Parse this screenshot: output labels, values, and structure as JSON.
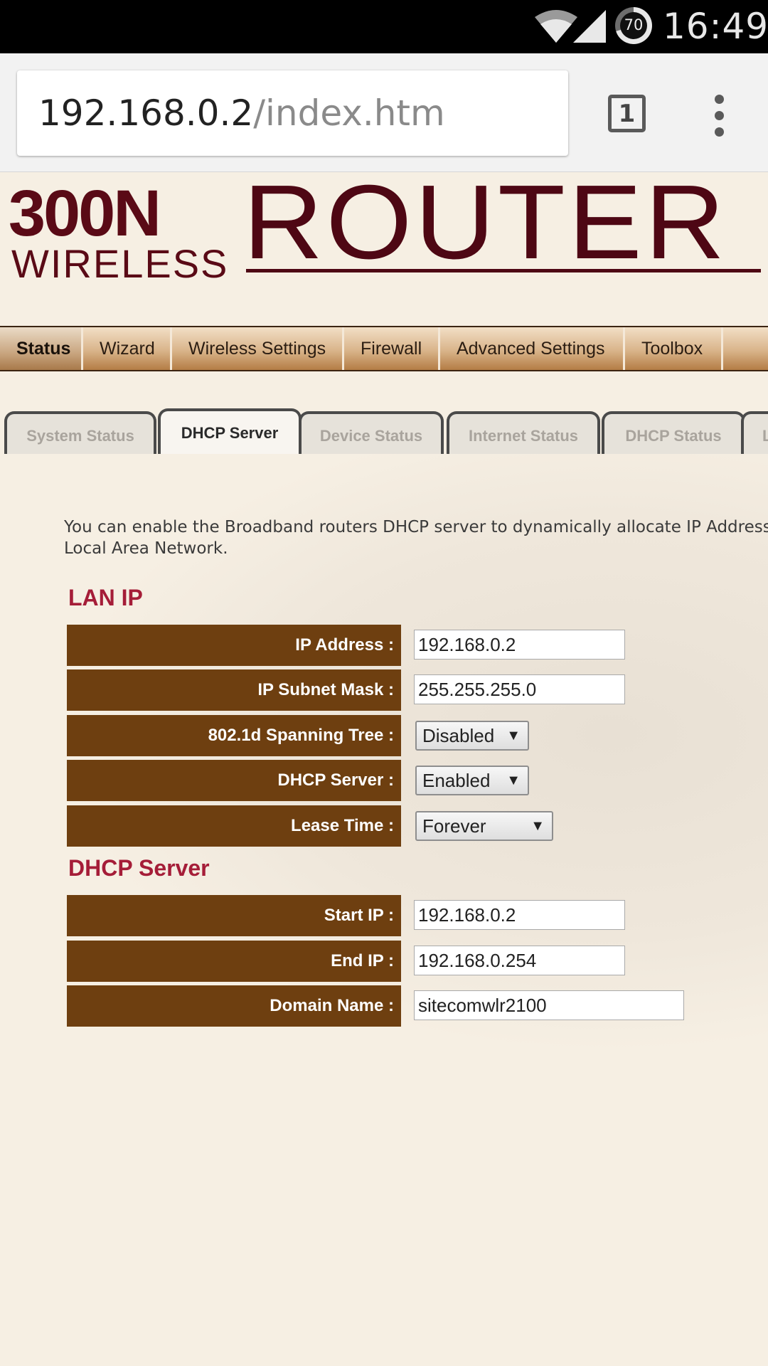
{
  "status_bar": {
    "battery_level": "70",
    "time": "16:49"
  },
  "browser": {
    "url_host": "192.168.0.2",
    "url_path": "/index.htm",
    "tab_count": "1"
  },
  "logo": {
    "line1": "300N",
    "line2": "WIRELESS",
    "product": "ROUTER"
  },
  "main_nav": [
    {
      "label": "Status",
      "active": true
    },
    {
      "label": "Wizard"
    },
    {
      "label": "Wireless Settings"
    },
    {
      "label": "Firewall"
    },
    {
      "label": "Advanced Settings"
    },
    {
      "label": "Toolbox"
    }
  ],
  "sub_tabs": [
    {
      "label": "System Status"
    },
    {
      "label": "DHCP Server",
      "active": true
    },
    {
      "label": "Device Status"
    },
    {
      "label": "Internet Status"
    },
    {
      "label": "DHCP Status"
    },
    {
      "label": "L"
    }
  ],
  "intro": {
    "line1": "You can enable the Broadband routers DHCP server to dynamically allocate IP Addresses",
    "line2": "Local Area Network."
  },
  "lan_ip": {
    "title": "LAN IP",
    "ip_address": {
      "label": "IP Address :",
      "value": "192.168.0.2"
    },
    "subnet_mask": {
      "label": "IP Subnet Mask :",
      "value": "255.255.255.0"
    },
    "spanning_tree": {
      "label": "802.1d Spanning Tree :",
      "value": "Disabled"
    },
    "dhcp_server": {
      "label": "DHCP Server :",
      "value": "Enabled"
    },
    "lease_time": {
      "label": "Lease Time :",
      "value": "Forever"
    }
  },
  "dhcp_server": {
    "title": "DHCP Server",
    "start_ip": {
      "label": "Start IP :",
      "value": "192.168.0.2"
    },
    "end_ip": {
      "label": "End IP :",
      "value": "192.168.0.254"
    },
    "domain_name": {
      "label": "Domain Name :",
      "value": "sitecomwlr2100"
    }
  },
  "colors": {
    "label_bg": "#6e3f10",
    "section_title": "#a51d38",
    "logo": "#4e0714",
    "page_bg": "#f6efe3"
  },
  "icons": [
    "wifi-icon",
    "cell-signal-icon",
    "battery-icon",
    "tab-switcher-icon",
    "overflow-menu-icon",
    "dropdown-arrow-icon"
  ]
}
